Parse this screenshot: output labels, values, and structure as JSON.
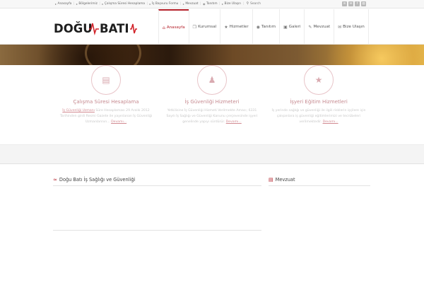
{
  "topbar": {
    "links": [
      {
        "label": "Anasayfa"
      },
      {
        "label": "Bölgelerimiz"
      },
      {
        "label": "Çalışma Süresi Hesaplama"
      },
      {
        "label": "İş Başvuru Formu"
      },
      {
        "label": "Mevzuat"
      },
      {
        "label": "Tanıtım"
      },
      {
        "label": "Bize Ulaşın"
      }
    ],
    "search_label": "Search",
    "social_icons": [
      "rss-icon",
      "email-icon",
      "facebook-icon",
      "message-icon"
    ]
  },
  "logo": {
    "text_left": "DOĞU",
    "text_right": "BATI",
    "colors": {
      "text": "#1e1e1e",
      "accent": "#d2232a"
    }
  },
  "mainnav": {
    "items": [
      {
        "label": "Anasayfa",
        "icon": "home-icon",
        "active": true
      },
      {
        "label": "Kurumsal",
        "icon": "book-icon"
      },
      {
        "label": "Hizmetler",
        "icon": "star-icon"
      },
      {
        "label": "Tanıtım",
        "icon": "globe-icon"
      },
      {
        "label": "Galeri",
        "icon": "image-icon"
      },
      {
        "label": "Mevzuat",
        "icon": "edit-icon"
      },
      {
        "label": "Bize Ulaşın",
        "icon": "envelope-icon"
      }
    ]
  },
  "services": [
    {
      "icon": "clipboard-icon",
      "title": "Çalışma Süresi Hesaplama",
      "desc_link": "İş Güvenliği Uzmanı",
      "desc": " Süre Hesaplaması 29 Aralık 2012 Tarihinden girdi Resmi Gazete ile yayınlanan İş Güvenliği Uzmanlarının...",
      "more": "Devamı..."
    },
    {
      "icon": "users-icon",
      "title": "İş Güvenliği Hizmeteri",
      "desc_link": "",
      "desc": "Yetkilisine İş Güvenliği Hizmeti Verilmekte Amacı; 6331 Sayılı İş Sağlığı ve Güvenliği Kanunu çerçevesinde işyeri genelinde yapıyı sürdürür.",
      "more": "Devamı..."
    },
    {
      "icon": "star-icon",
      "title": "İşyeri Eğitim Hizmetleri",
      "desc_link": "",
      "desc": "İş yerinde sağlığı ve güvenliği ile ilgili risklerin işçilere için çalışanlara iş güvenliği eğitimlerimizi ve tecrübeleri verilmektedir.",
      "more": "Devamı..."
    }
  ],
  "sections": {
    "left_title": "Doğu Batı İş Sağlığı ve Güvenliği",
    "right_title": "Mevzuat"
  },
  "colors": {
    "accent": "#b5202a",
    "soft_accent": "#e8c4c8"
  }
}
